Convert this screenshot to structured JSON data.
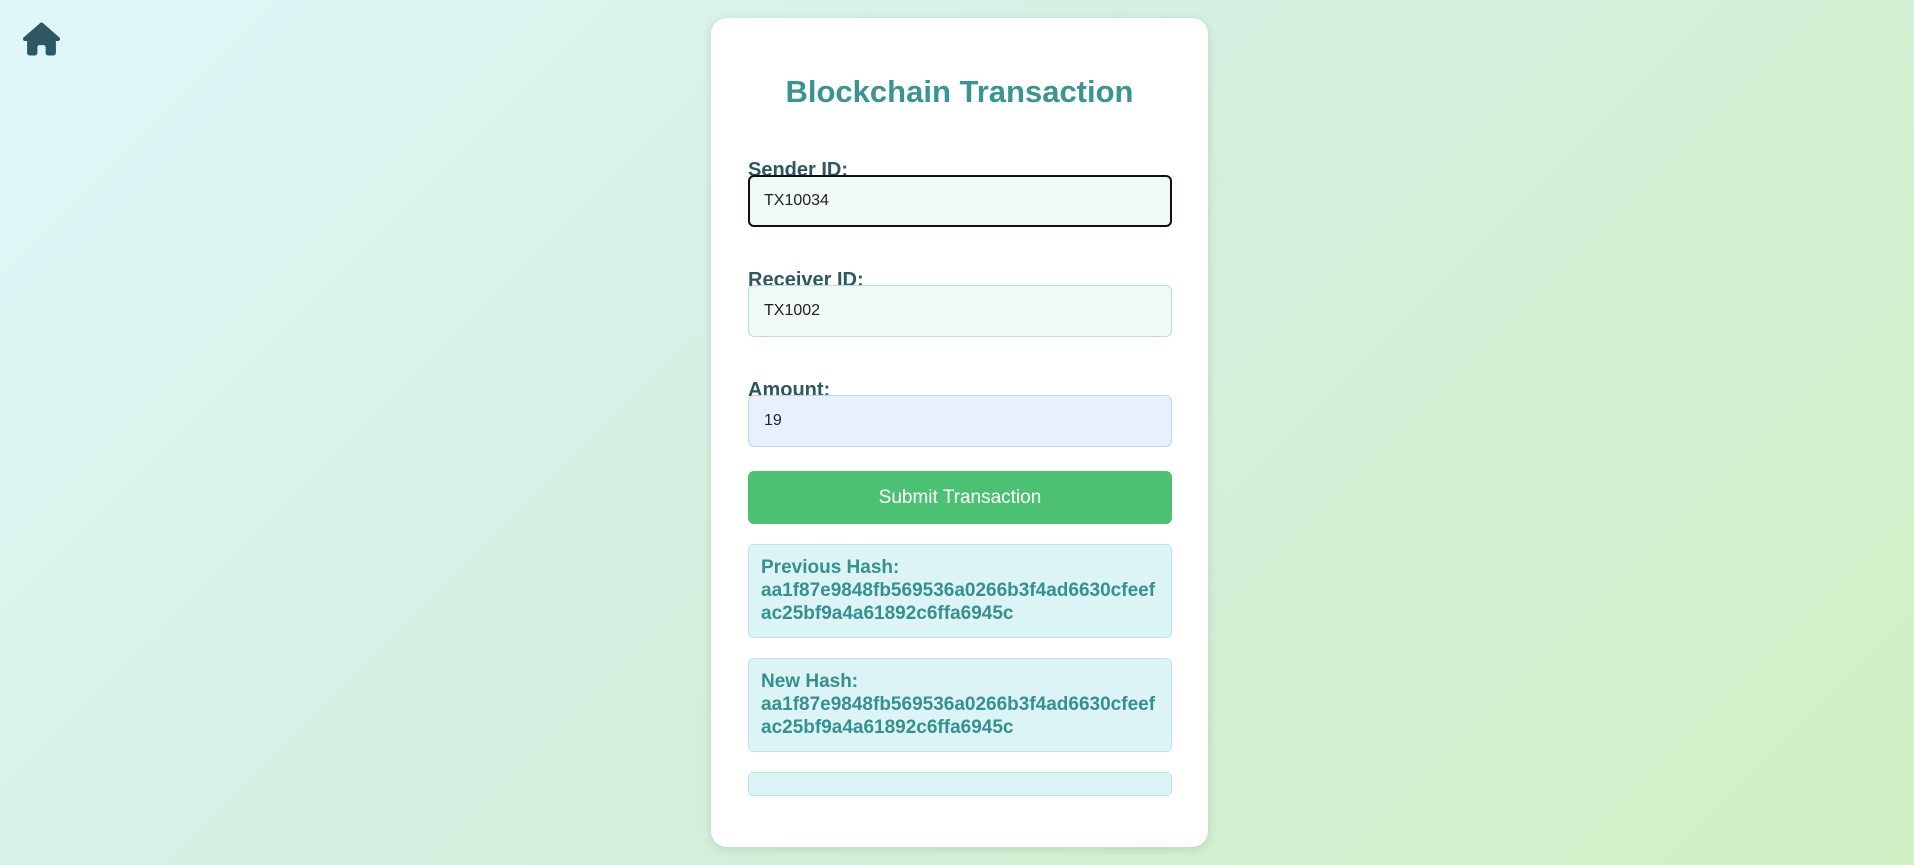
{
  "nav": {
    "home_icon": "home-icon"
  },
  "form": {
    "title": "Blockchain Transaction",
    "sender_label": "Sender ID:",
    "sender_value": "TX10034",
    "receiver_label": "Receiver ID:",
    "receiver_value": "TX1002",
    "amount_label": "Amount:",
    "amount_value": "19",
    "submit_label": "Submit Transaction"
  },
  "results": {
    "previous_hash_label": "Previous Hash:",
    "previous_hash_value": "aa1f87e9848fb569536a0266b3f4ad6630cfeefac25bf9a4a61892c6ffa6945c",
    "new_hash_label": "New Hash:",
    "new_hash_value": "aa1f87e9848fb569536a0266b3f4ad6630cfeefac25bf9a4a61892c6ffa6945c"
  },
  "colors": {
    "accent": "#3a9490",
    "button": "#4cc173",
    "label_text": "#2c5763",
    "home_icon": "#2c5763"
  }
}
